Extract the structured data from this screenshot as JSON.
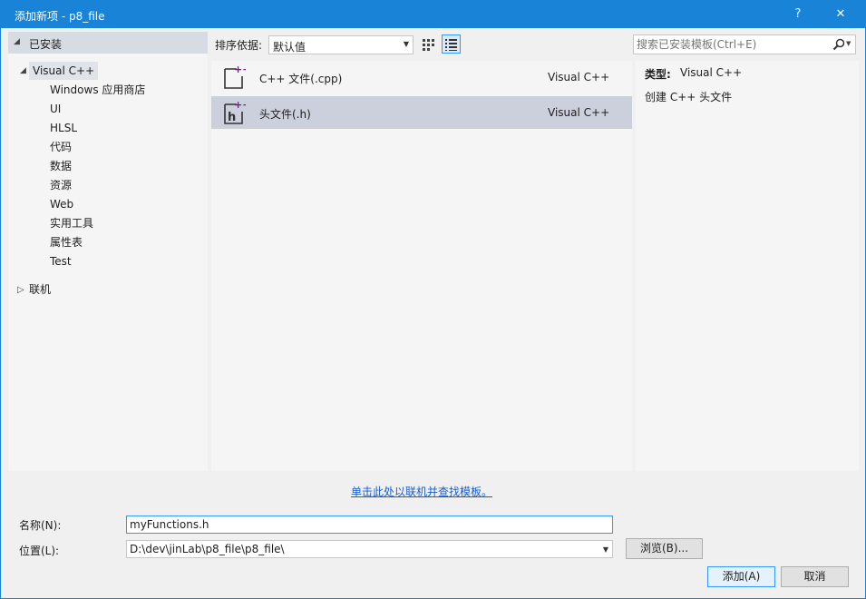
{
  "window": {
    "title": "添加新项 - p8_file",
    "help_glyph": "?",
    "close_glyph": "✕"
  },
  "tree": {
    "installed_header": "已安装",
    "root": "Visual C++",
    "children": [
      "Windows 应用商店",
      "UI",
      "HLSL",
      "代码",
      "数据",
      "资源",
      "Web",
      "实用工具",
      "属性表",
      "Test"
    ],
    "online": "联机"
  },
  "toolbar": {
    "sort_label": "排序依据:",
    "sort_value": "默认值",
    "search_placeholder": "搜索已安装模板(Ctrl+E)"
  },
  "templates": [
    {
      "name": "C++ 文件(.cpp)",
      "language": "Visual C++",
      "selected": false,
      "icon": "cpp-file-icon"
    },
    {
      "name": "头文件(.h)",
      "language": "Visual C++",
      "selected": true,
      "icon": "header-file-icon"
    }
  ],
  "info": {
    "type_label": "类型:",
    "type_value": "Visual C++",
    "description": "创建 C++ 头文件"
  },
  "online_link": "单击此处以联机并查找模板。",
  "form": {
    "name_label": "名称(N):",
    "name_value": "myFunctions.h",
    "location_label": "位置(L):",
    "location_value": "D:\\dev\\jinLab\\p8_file\\p8_file\\",
    "browse_label": "浏览(B)...",
    "add_label": "添加(A)",
    "cancel_label": "取消"
  },
  "colors": {
    "accent": "#1883d7",
    "selected_row": "#ccd0dc",
    "link": "#1a5ed1"
  }
}
